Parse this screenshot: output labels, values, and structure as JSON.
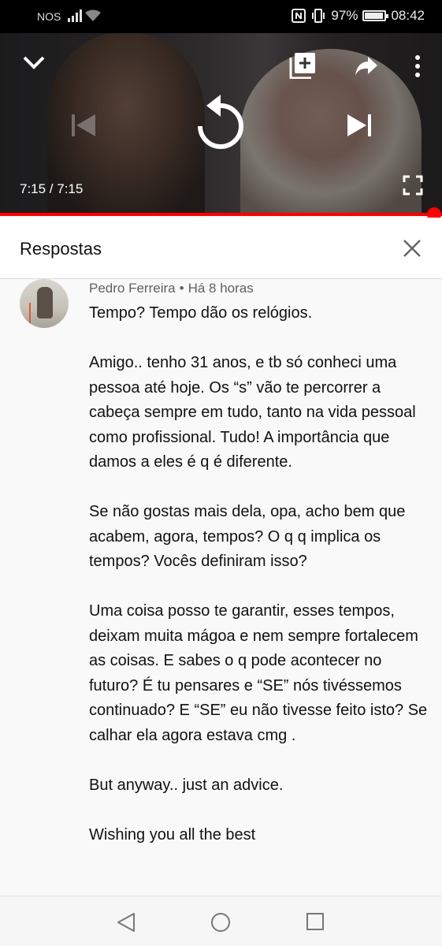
{
  "status_bar": {
    "carrier": "NOS",
    "battery_text": "97%",
    "battery_level": 0.97,
    "time": "08:42"
  },
  "player": {
    "time_display": "7:15 / 7:15",
    "progress": 1.0,
    "progress_color": "#ff0000",
    "icons": [
      "chevron-down-icon",
      "add-to-playlist-icon",
      "share-icon",
      "more-vert-icon",
      "skip-previous-icon",
      "replay-icon",
      "skip-next-icon",
      "fullscreen-icon"
    ]
  },
  "panel": {
    "title": "Respostas",
    "close_icon": "close-icon"
  },
  "comment": {
    "author": "Pedro Ferreira",
    "separator": "•",
    "age": "Há 8 horas",
    "paragraphs": [
      "Tempo? Tempo dão os relógios.",
      "Amigo.. tenho 31 anos, e tb só conheci uma pessoa até hoje. Os “s” vão te percorrer a cabeça sempre em tudo, tanto na vida pessoal como profissional. Tudo! A importância que damos a eles é q é diferente.",
      "Se não gostas mais dela, opa, acho bem que acabem, agora, tempos? O q q implica os tempos? Vocês definiram isso?",
      "Uma coisa posso te garantir, esses tempos, deixam muita mágoa e nem sempre fortalecem as coisas. E sabes o q pode acontecer no futuro? É tu pensares  e “SE” nós tivéssemos continuado? E “SE” eu não tivesse feito isto? Se calhar ela agora estava cmg .",
      "But anyway.. just an advice.",
      "Wishing you all the best"
    ]
  },
  "nav_bar": {
    "icons": [
      "back-triangle-icon",
      "home-circle-icon",
      "recents-square-icon"
    ]
  }
}
